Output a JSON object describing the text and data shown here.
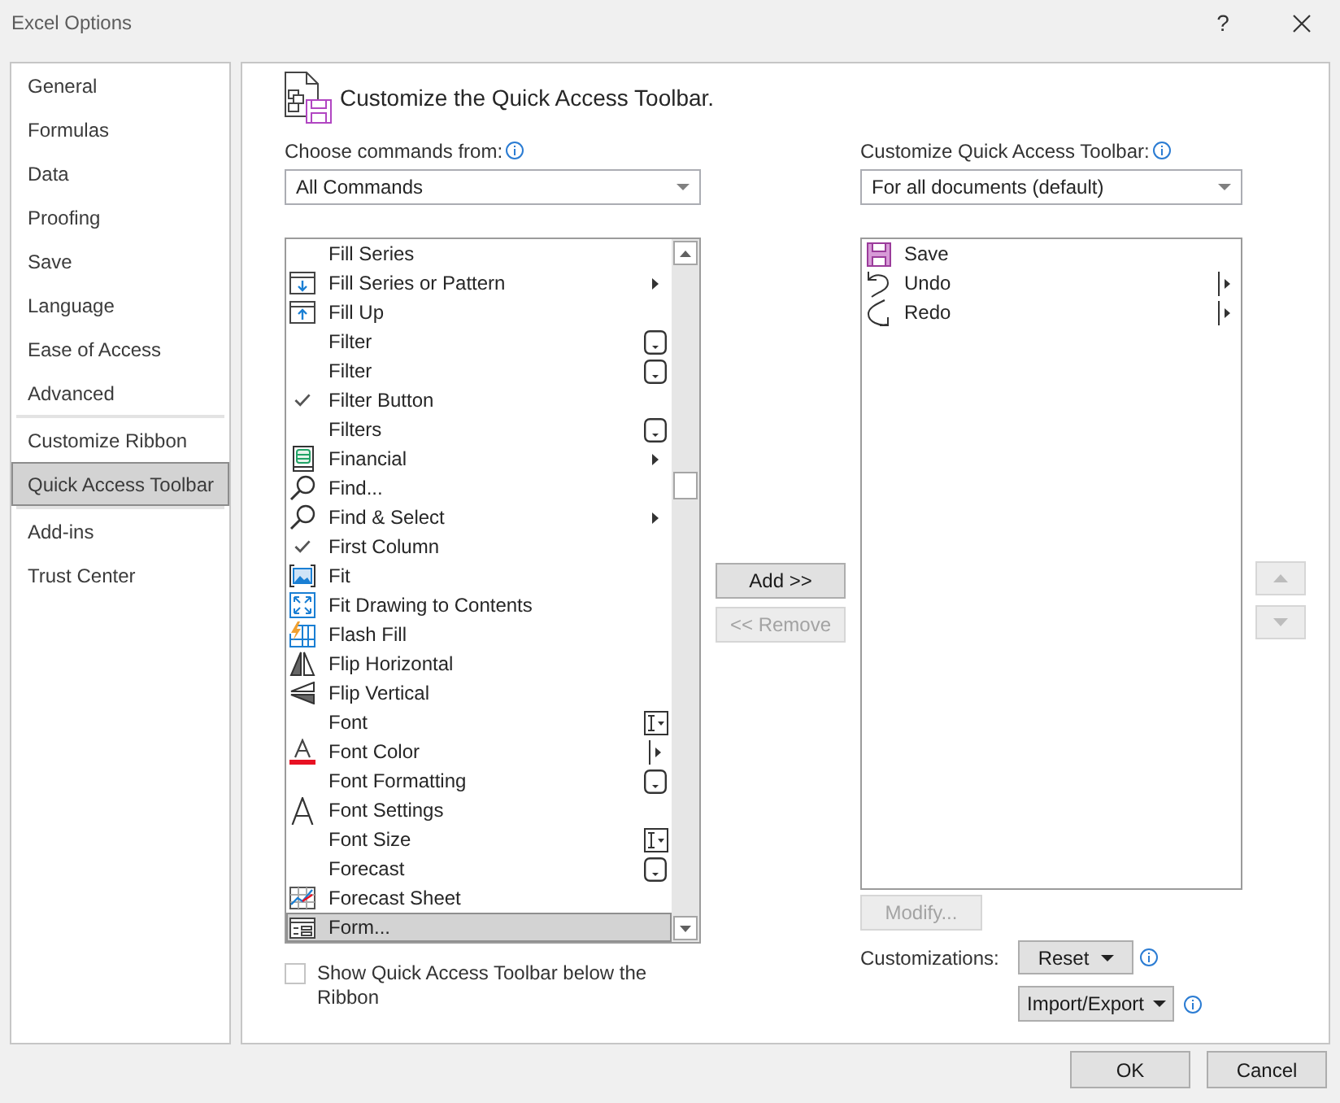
{
  "title_bar": {
    "title": "Excel Options",
    "help": "?"
  },
  "sidebar": {
    "groups": [
      [
        {
          "label": "General",
          "selected": false
        },
        {
          "label": "Formulas",
          "selected": false
        },
        {
          "label": "Data",
          "selected": false
        },
        {
          "label": "Proofing",
          "selected": false
        },
        {
          "label": "Save",
          "selected": false
        },
        {
          "label": "Language",
          "selected": false
        },
        {
          "label": "Ease of Access",
          "selected": false
        },
        {
          "label": "Advanced",
          "selected": false
        }
      ],
      [
        {
          "label": "Customize Ribbon",
          "selected": false
        },
        {
          "label": "Quick Access Toolbar",
          "selected": true
        }
      ],
      [
        {
          "label": "Add-ins",
          "selected": false
        },
        {
          "label": "Trust Center",
          "selected": false
        }
      ]
    ]
  },
  "heading": "Customize the Quick Access Toolbar.",
  "commands": {
    "label": "Choose commands from:",
    "dropdown": "All Commands",
    "items": [
      {
        "label": "Fill Series",
        "selected": false
      },
      {
        "label": "Fill Series or Pattern",
        "icon": {
          "kind": "filldown"
        },
        "indicator": {
          "kind": "submenu"
        },
        "selected": false
      },
      {
        "label": "Fill Up",
        "icon": {
          "kind": "fillup"
        },
        "selected": false
      },
      {
        "label": "Filter",
        "indicator": {
          "kind": "dropdown"
        },
        "selected": false
      },
      {
        "label": "Filter",
        "indicator": {
          "kind": "dropdown"
        },
        "selected": false
      },
      {
        "label": "Filter Button",
        "icon": {
          "kind": "check"
        },
        "selected": false
      },
      {
        "label": "Filters",
        "indicator": {
          "kind": "dropdown"
        },
        "selected": false
      },
      {
        "label": "Financial",
        "icon": {
          "kind": "ledger"
        },
        "indicator": {
          "kind": "submenu"
        },
        "selected": false
      },
      {
        "label": "Find...",
        "icon": {
          "kind": "find"
        },
        "selected": false
      },
      {
        "label": "Find & Select",
        "icon": {
          "kind": "find"
        },
        "indicator": {
          "kind": "submenu"
        },
        "selected": false
      },
      {
        "label": "First Column",
        "icon": {
          "kind": "check"
        },
        "selected": false
      },
      {
        "label": "Fit",
        "icon": {
          "kind": "picture"
        },
        "selected": false
      },
      {
        "label": "Fit Drawing to Contents",
        "icon": {
          "kind": "expand"
        },
        "selected": false
      },
      {
        "label": "Flash Fill",
        "icon": {
          "kind": "flashfill"
        },
        "selected": false
      },
      {
        "label": "Flip Horizontal",
        "icon": {
          "kind": "fliph"
        },
        "selected": false
      },
      {
        "label": "Flip Vertical",
        "icon": {
          "kind": "flipv"
        },
        "selected": false
      },
      {
        "label": "Font",
        "indicator": {
          "kind": "combo"
        },
        "selected": false
      },
      {
        "label": "Font Color",
        "icon": {
          "kind": "fontcolor"
        },
        "indicator": {
          "kind": "split"
        },
        "selected": false
      },
      {
        "label": "Font Formatting",
        "indicator": {
          "kind": "dropdown"
        },
        "selected": false
      },
      {
        "label": "Font Settings",
        "icon": {
          "kind": "letter"
        },
        "selected": false
      },
      {
        "label": "Font Size",
        "indicator": {
          "kind": "combo"
        },
        "selected": false
      },
      {
        "label": "Forecast",
        "indicator": {
          "kind": "dropdown"
        },
        "selected": false
      },
      {
        "label": "Forecast Sheet",
        "icon": {
          "kind": "chart"
        },
        "selected": false
      },
      {
        "label": "Form...",
        "icon": {
          "kind": "form"
        },
        "selected": true
      }
    ]
  },
  "show_below_ribbon": {
    "label": "Show Quick Access Toolbar below the Ribbon",
    "checked": false
  },
  "add_button": {
    "label": "Add >>",
    "disabled": false
  },
  "remove_button": {
    "label": "<< Remove",
    "disabled": true
  },
  "toolbar": {
    "label": "Customize Quick Access Toolbar:",
    "dropdown": "For all documents (default)",
    "items": [
      {
        "label": "Save",
        "icon": {
          "kind": "save"
        },
        "selected": false
      },
      {
        "label": "Undo",
        "icon": {
          "kind": "undo"
        },
        "indicator": {
          "kind": "split"
        },
        "selected": false
      },
      {
        "label": "Redo",
        "icon": {
          "kind": "redo"
        },
        "indicator": {
          "kind": "split"
        },
        "selected": false
      }
    ]
  },
  "move_up": {
    "disabled": true
  },
  "move_down": {
    "disabled": true
  },
  "modify_button": {
    "label": "Modify...",
    "disabled": true
  },
  "customizations": {
    "label": "Customizations:",
    "reset": "Reset",
    "import_export": "Import/Export"
  },
  "buttons": [
    {
      "label": "OK"
    },
    {
      "label": "Cancel"
    }
  ]
}
